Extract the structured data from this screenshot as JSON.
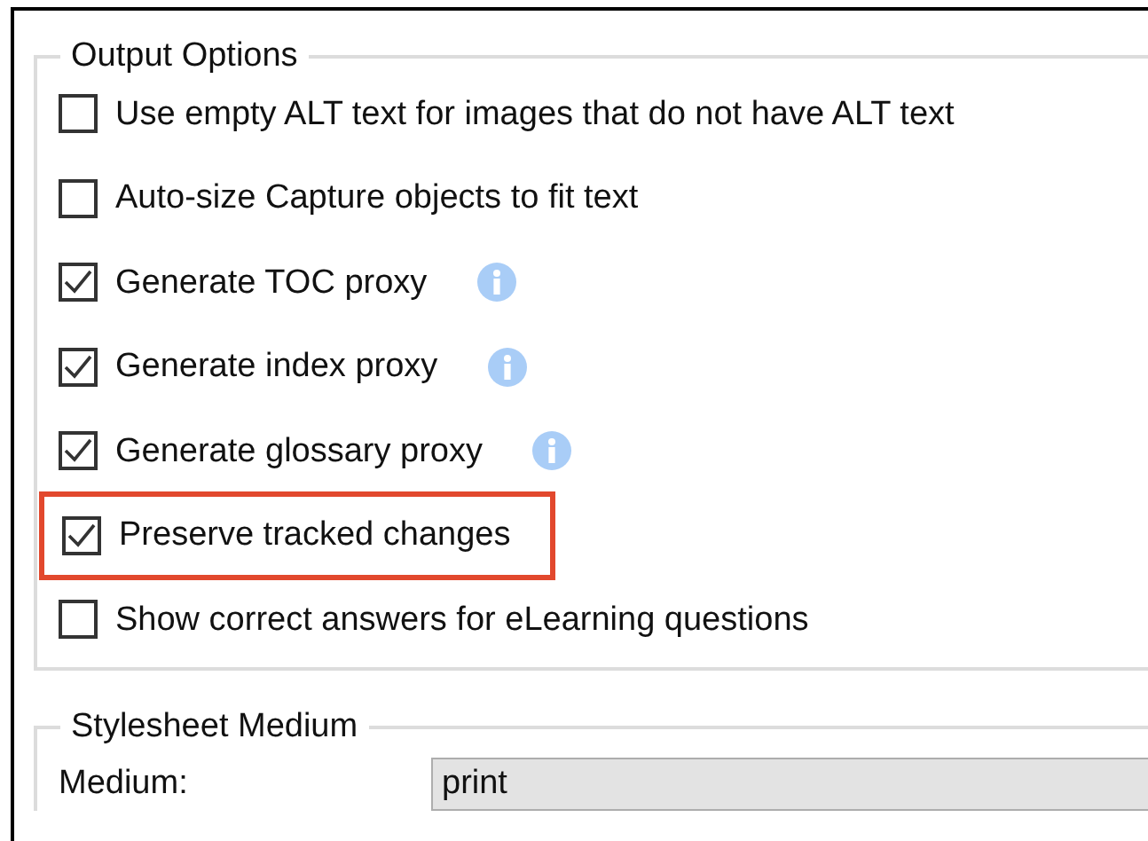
{
  "output_options": {
    "title": "Output Options",
    "items": [
      {
        "label": "Use empty ALT text for images that do not have ALT text",
        "checked": false,
        "info_icon": false,
        "highlighted": false
      },
      {
        "label": "Auto-size Capture objects to fit text",
        "checked": false,
        "info_icon": false,
        "highlighted": false
      },
      {
        "label": "Generate TOC proxy",
        "checked": true,
        "info_icon": true,
        "highlighted": false
      },
      {
        "label": "Generate index proxy",
        "checked": true,
        "info_icon": true,
        "highlighted": false
      },
      {
        "label": "Generate glossary proxy",
        "checked": true,
        "info_icon": true,
        "highlighted": false
      },
      {
        "label": "Preserve tracked changes",
        "checked": true,
        "info_icon": false,
        "highlighted": true
      },
      {
        "label": "Show correct answers for eLearning questions",
        "checked": false,
        "info_icon": false,
        "highlighted": false
      }
    ]
  },
  "stylesheet_medium": {
    "title": "Stylesheet Medium",
    "field_label": "Medium:",
    "field_value": "print"
  }
}
